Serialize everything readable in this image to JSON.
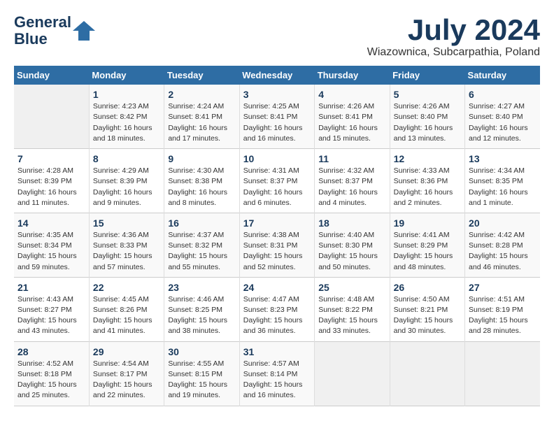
{
  "logo": {
    "line1": "General",
    "line2": "Blue"
  },
  "title": "July 2024",
  "location": "Wiazownica, Subcarpathia, Poland",
  "days_of_week": [
    "Sunday",
    "Monday",
    "Tuesday",
    "Wednesday",
    "Thursday",
    "Friday",
    "Saturday"
  ],
  "weeks": [
    [
      {
        "num": "",
        "info": ""
      },
      {
        "num": "1",
        "info": "Sunrise: 4:23 AM\nSunset: 8:42 PM\nDaylight: 16 hours\nand 18 minutes."
      },
      {
        "num": "2",
        "info": "Sunrise: 4:24 AM\nSunset: 8:41 PM\nDaylight: 16 hours\nand 17 minutes."
      },
      {
        "num": "3",
        "info": "Sunrise: 4:25 AM\nSunset: 8:41 PM\nDaylight: 16 hours\nand 16 minutes."
      },
      {
        "num": "4",
        "info": "Sunrise: 4:26 AM\nSunset: 8:41 PM\nDaylight: 16 hours\nand 15 minutes."
      },
      {
        "num": "5",
        "info": "Sunrise: 4:26 AM\nSunset: 8:40 PM\nDaylight: 16 hours\nand 13 minutes."
      },
      {
        "num": "6",
        "info": "Sunrise: 4:27 AM\nSunset: 8:40 PM\nDaylight: 16 hours\nand 12 minutes."
      }
    ],
    [
      {
        "num": "7",
        "info": "Sunrise: 4:28 AM\nSunset: 8:39 PM\nDaylight: 16 hours\nand 11 minutes."
      },
      {
        "num": "8",
        "info": "Sunrise: 4:29 AM\nSunset: 8:39 PM\nDaylight: 16 hours\nand 9 minutes."
      },
      {
        "num": "9",
        "info": "Sunrise: 4:30 AM\nSunset: 8:38 PM\nDaylight: 16 hours\nand 8 minutes."
      },
      {
        "num": "10",
        "info": "Sunrise: 4:31 AM\nSunset: 8:37 PM\nDaylight: 16 hours\nand 6 minutes."
      },
      {
        "num": "11",
        "info": "Sunrise: 4:32 AM\nSunset: 8:37 PM\nDaylight: 16 hours\nand 4 minutes."
      },
      {
        "num": "12",
        "info": "Sunrise: 4:33 AM\nSunset: 8:36 PM\nDaylight: 16 hours\nand 2 minutes."
      },
      {
        "num": "13",
        "info": "Sunrise: 4:34 AM\nSunset: 8:35 PM\nDaylight: 16 hours\nand 1 minute."
      }
    ],
    [
      {
        "num": "14",
        "info": "Sunrise: 4:35 AM\nSunset: 8:34 PM\nDaylight: 15 hours\nand 59 minutes."
      },
      {
        "num": "15",
        "info": "Sunrise: 4:36 AM\nSunset: 8:33 PM\nDaylight: 15 hours\nand 57 minutes."
      },
      {
        "num": "16",
        "info": "Sunrise: 4:37 AM\nSunset: 8:32 PM\nDaylight: 15 hours\nand 55 minutes."
      },
      {
        "num": "17",
        "info": "Sunrise: 4:38 AM\nSunset: 8:31 PM\nDaylight: 15 hours\nand 52 minutes."
      },
      {
        "num": "18",
        "info": "Sunrise: 4:40 AM\nSunset: 8:30 PM\nDaylight: 15 hours\nand 50 minutes."
      },
      {
        "num": "19",
        "info": "Sunrise: 4:41 AM\nSunset: 8:29 PM\nDaylight: 15 hours\nand 48 minutes."
      },
      {
        "num": "20",
        "info": "Sunrise: 4:42 AM\nSunset: 8:28 PM\nDaylight: 15 hours\nand 46 minutes."
      }
    ],
    [
      {
        "num": "21",
        "info": "Sunrise: 4:43 AM\nSunset: 8:27 PM\nDaylight: 15 hours\nand 43 minutes."
      },
      {
        "num": "22",
        "info": "Sunrise: 4:45 AM\nSunset: 8:26 PM\nDaylight: 15 hours\nand 41 minutes."
      },
      {
        "num": "23",
        "info": "Sunrise: 4:46 AM\nSunset: 8:25 PM\nDaylight: 15 hours\nand 38 minutes."
      },
      {
        "num": "24",
        "info": "Sunrise: 4:47 AM\nSunset: 8:23 PM\nDaylight: 15 hours\nand 36 minutes."
      },
      {
        "num": "25",
        "info": "Sunrise: 4:48 AM\nSunset: 8:22 PM\nDaylight: 15 hours\nand 33 minutes."
      },
      {
        "num": "26",
        "info": "Sunrise: 4:50 AM\nSunset: 8:21 PM\nDaylight: 15 hours\nand 30 minutes."
      },
      {
        "num": "27",
        "info": "Sunrise: 4:51 AM\nSunset: 8:19 PM\nDaylight: 15 hours\nand 28 minutes."
      }
    ],
    [
      {
        "num": "28",
        "info": "Sunrise: 4:52 AM\nSunset: 8:18 PM\nDaylight: 15 hours\nand 25 minutes."
      },
      {
        "num": "29",
        "info": "Sunrise: 4:54 AM\nSunset: 8:17 PM\nDaylight: 15 hours\nand 22 minutes."
      },
      {
        "num": "30",
        "info": "Sunrise: 4:55 AM\nSunset: 8:15 PM\nDaylight: 15 hours\nand 19 minutes."
      },
      {
        "num": "31",
        "info": "Sunrise: 4:57 AM\nSunset: 8:14 PM\nDaylight: 15 hours\nand 16 minutes."
      },
      {
        "num": "",
        "info": ""
      },
      {
        "num": "",
        "info": ""
      },
      {
        "num": "",
        "info": ""
      }
    ]
  ]
}
